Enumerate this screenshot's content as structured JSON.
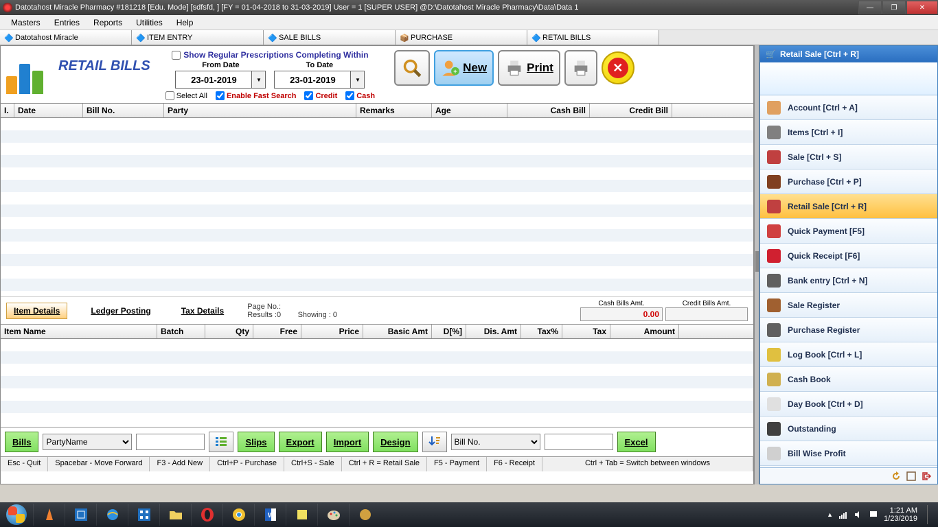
{
  "titlebar": "Datotahost Miracle Pharmacy #181218  [Edu. Mode]  [sdfsfd, ] [FY = 01-04-2018 to 31-03-2019] User = 1 [SUPER USER]  @D:\\Datotahost Miracle Pharmacy\\Data\\Data 1",
  "menu": [
    "Masters",
    "Entries",
    "Reports",
    "Utilities",
    "Help"
  ],
  "wintabs": [
    "Datotahost Miracle",
    "ITEM ENTRY",
    "SALE BILLS",
    "PURCHASE",
    "RETAIL BILLS"
  ],
  "page_title": "RETAIL BILLS",
  "prescrip_label": "Show Regular Prescriptions Completing Within",
  "from_label": "From Date",
  "to_label": "To Date",
  "from_date": "23-01-2019",
  "to_date": "23-01-2019",
  "chk": {
    "select_all": "Select All",
    "fast": "Enable Fast Search",
    "credit": "Credit",
    "cash": "Cash"
  },
  "btn": {
    "new": "New",
    "print": "Print"
  },
  "grid_cols": [
    "I.",
    "Date",
    "Bill No.",
    "Party",
    "Remarks",
    "Age",
    "Cash Bill",
    "Credit Bill"
  ],
  "tabs": {
    "item": "Item Details",
    "ledger": "Ledger Posting",
    "tax": "Tax Details"
  },
  "pageinfo": {
    "pageno": "Page No.:",
    "results": "Results :0",
    "showing": "Showing :   0"
  },
  "amt": {
    "cash_lbl": "Cash Bills Amt.",
    "cash_val": "0.00",
    "credit_lbl": "Credit Bills Amt.",
    "credit_val": ""
  },
  "detail_cols": [
    "Item Name",
    "Batch",
    "Qty",
    "Free",
    "Price",
    "Basic Amt",
    "D[%]",
    "Dis. Amt",
    "Tax%",
    "Tax",
    "Amount"
  ],
  "bottom": {
    "bills": "Bills",
    "party_sel": "PartyName",
    "slips": "Slips",
    "export": "Export",
    "import": "Import",
    "design": "Design",
    "billno_sel": "Bill No.",
    "excel": "Excel"
  },
  "hints": [
    "Esc - Quit",
    "Spacebar - Move Forward",
    "F3 - Add New",
    "Ctrl+P - Purchase",
    "Ctrl+S - Sale",
    "Ctrl + R = Retail Sale",
    "F5 - Payment",
    "F6 - Receipt",
    "Ctrl + Tab = Switch between windows"
  ],
  "side_title": "Retail Sale [Ctrl + R]",
  "side_items": [
    {
      "label": "Account [Ctrl + A]",
      "color": "#e0a060"
    },
    {
      "label": "Items [Ctrl + I]",
      "color": "#808080"
    },
    {
      "label": "Sale [Ctrl + S]",
      "color": "#c04040"
    },
    {
      "label": "Purchase [Ctrl + P]",
      "color": "#804020"
    },
    {
      "label": "Retail Sale [Ctrl + R]",
      "color": "#c04040",
      "sel": true
    },
    {
      "label": "Quick Payment [F5]",
      "color": "#d04040"
    },
    {
      "label": "Quick Receipt [F6]",
      "color": "#d02030"
    },
    {
      "label": "Bank entry [Ctrl + N]",
      "color": "#606060"
    },
    {
      "label": "Sale Register",
      "color": "#a06030"
    },
    {
      "label": "Purchase Register",
      "color": "#606060"
    },
    {
      "label": "Log Book [Ctrl + L]",
      "color": "#e0c040"
    },
    {
      "label": "Cash Book",
      "color": "#d0b050"
    },
    {
      "label": "Day Book [Ctrl + D]",
      "color": "#e0e0e0"
    },
    {
      "label": "Outstanding",
      "color": "#404040"
    },
    {
      "label": "Bill Wise Profit",
      "color": "#d0d0d0"
    }
  ],
  "clock": {
    "time": "1:21 AM",
    "date": "1/23/2019"
  }
}
